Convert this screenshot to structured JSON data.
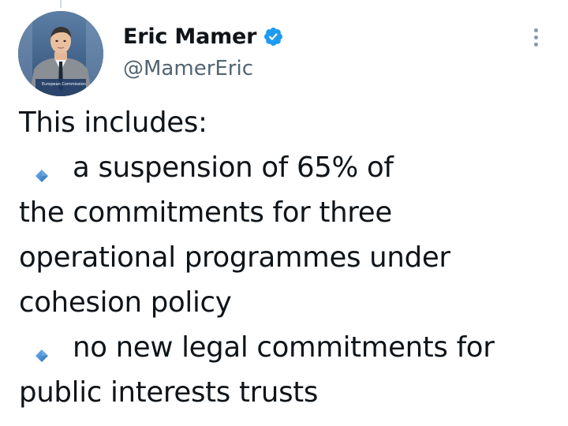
{
  "author": {
    "display_name": "Eric Mamer",
    "handle": "@MamerEric",
    "verified": true,
    "avatar_caption": "European Commission"
  },
  "tweet": {
    "intro": "This includes:",
    "bullet_1_first_line": "a suspension of 65% of",
    "bullet_1_continuation": [
      "the commitments for three",
      "operational programmes under",
      "cohesion policy"
    ],
    "bullet_2_first_line": "no new legal commitments for",
    "bullet_2_continuation": [
      "public interests trusts"
    ]
  },
  "icons": {
    "verified": "verified-badge-icon",
    "more": "more-options-icon",
    "bullet": "small-blue-diamond-icon"
  },
  "colors": {
    "text": "#0f1419",
    "secondary_text": "#536471",
    "verified_blue": "#1d9bf0",
    "diamond_blue": "#3b88c3",
    "more_dots": "#8b98a5"
  }
}
